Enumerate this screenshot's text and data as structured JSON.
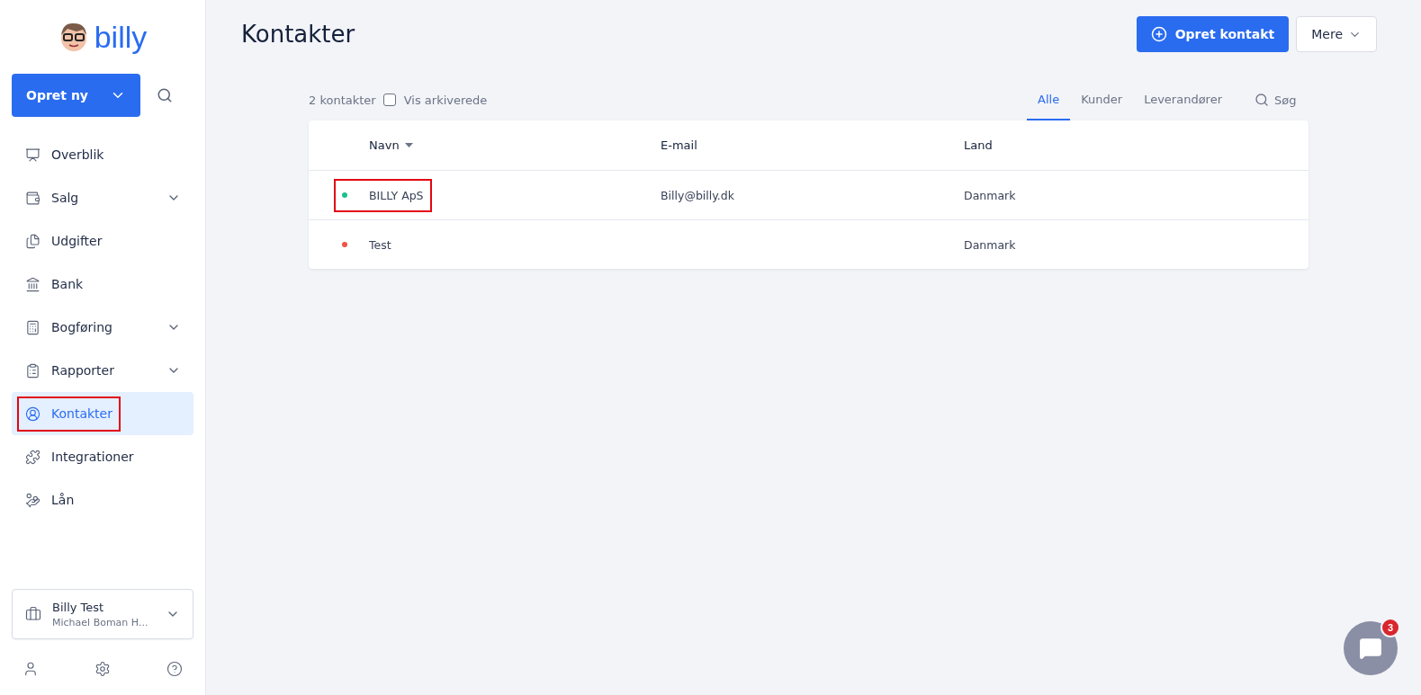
{
  "brand": {
    "name": "billy"
  },
  "create_button": {
    "label": "Opret ny"
  },
  "nav": [
    {
      "label": "Overblik",
      "expandable": false,
      "selected": false,
      "marked": false
    },
    {
      "label": "Salg",
      "expandable": true,
      "selected": false,
      "marked": false
    },
    {
      "label": "Udgifter",
      "expandable": false,
      "selected": false,
      "marked": false
    },
    {
      "label": "Bank",
      "expandable": false,
      "selected": false,
      "marked": false
    },
    {
      "label": "Bogføring",
      "expandable": true,
      "selected": false,
      "marked": false
    },
    {
      "label": "Rapporter",
      "expandable": true,
      "selected": false,
      "marked": false
    },
    {
      "label": "Kontakter",
      "expandable": false,
      "selected": true,
      "marked": true
    },
    {
      "label": "Integrationer",
      "expandable": false,
      "selected": false,
      "marked": false
    },
    {
      "label": "Lån",
      "expandable": false,
      "selected": false,
      "marked": false
    }
  ],
  "organization": {
    "name": "Billy Test",
    "user": "Michael Boman H..."
  },
  "page": {
    "title": "Kontakter",
    "primary_button": "Opret kontakt",
    "more_button": "Mere"
  },
  "toolbar": {
    "count": "2 kontakter",
    "show_archived": {
      "label": "Vis arkiverede",
      "checked": false
    },
    "filters": [
      {
        "label": "Alle",
        "selected": true
      },
      {
        "label": "Kunder",
        "selected": false
      },
      {
        "label": "Leverandører",
        "selected": false
      }
    ],
    "search": {
      "placeholder": "Søg"
    }
  },
  "table": {
    "columns": [
      {
        "label": "Navn",
        "sorted": true
      },
      {
        "label": "E-mail",
        "sorted": false
      },
      {
        "label": "Land",
        "sorted": false
      }
    ],
    "rows": [
      {
        "color": "#1fc08e",
        "name": "BILLY ApS",
        "email": "Billy@billy.dk",
        "country": "Danmark",
        "marked": true
      },
      {
        "color": "#ef5445",
        "name": "Test",
        "email": "",
        "country": "Danmark",
        "marked": false
      }
    ]
  },
  "chat": {
    "badge": "3"
  }
}
